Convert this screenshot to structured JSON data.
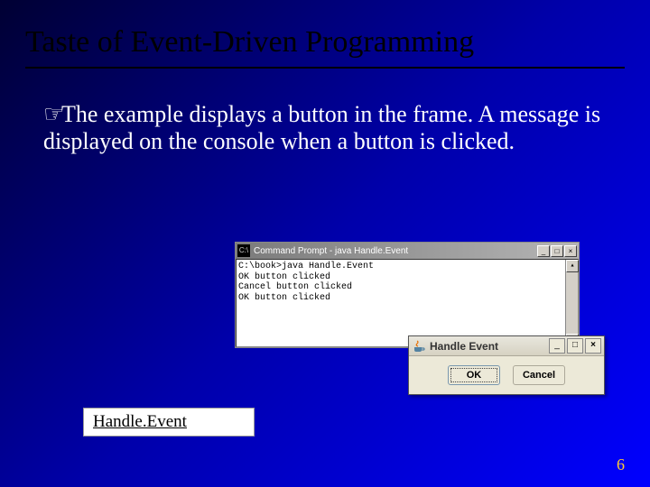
{
  "slide": {
    "title": "Taste of Event-Driven Programming",
    "bullet_glyph": "☞",
    "body": "The example displays a button in the frame. A message is displayed on the console when a button is clicked.",
    "page_number": "6"
  },
  "cmd_window": {
    "icon_glyph": "C:\\",
    "title": "Command Prompt - java  Handle.Event",
    "min_label": "_",
    "max_label": "□",
    "close_label": "×",
    "lines": [
      "C:\\book>java Handle.Event",
      "OK button clicked",
      "Cancel button clicked",
      "OK button clicked"
    ],
    "scroll_up": "▴",
    "scroll_down": "▾"
  },
  "java_window": {
    "title": "Handle Event",
    "min_label": "_",
    "max_label": "□",
    "close_label": "×",
    "ok_label": "OK",
    "cancel_label": "Cancel"
  },
  "link": {
    "label": "Handle.Event"
  }
}
